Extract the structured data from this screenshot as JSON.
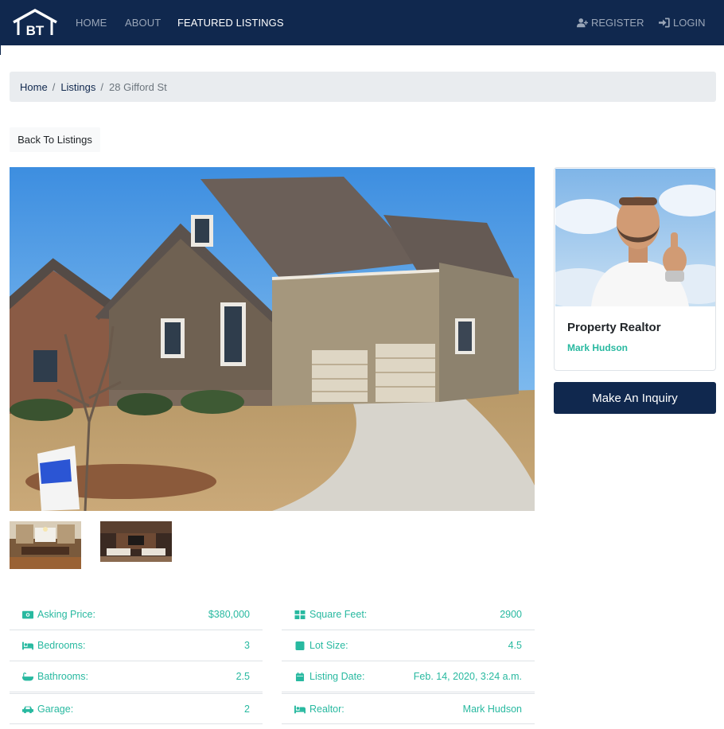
{
  "navbar": {
    "logo_text": "BT",
    "links": [
      "HOME",
      "ABOUT",
      "FEATURED LISTINGS"
    ],
    "register_label": "REGISTER",
    "login_label": "LOGIN"
  },
  "breadcrumb": {
    "home": "Home",
    "listings": "Listings",
    "separator": "/",
    "current": "28 Gifford St"
  },
  "back_button": "Back To Listings",
  "realtor_card": {
    "title": "Property Realtor",
    "name": "Mark Hudson"
  },
  "inquiry_button": "Make An Inquiry",
  "details_left": [
    {
      "icon": "money-icon",
      "label": "Asking Price:",
      "value": "$380,000"
    },
    {
      "icon": "bed-icon",
      "label": "Bedrooms:",
      "value": "3"
    },
    {
      "icon": "bath-icon",
      "label": "Bathrooms:",
      "value": "2.5"
    },
    {
      "icon": "car-icon",
      "label": "Garage:",
      "value": "2"
    }
  ],
  "details_right": [
    {
      "icon": "grid-icon",
      "label": "Square Feet:",
      "value": "2900"
    },
    {
      "icon": "square-icon",
      "label": "Lot Size:",
      "value": "4.5"
    },
    {
      "icon": "calendar-icon",
      "label": "Listing Date:",
      "value": "Feb. 14, 2020, 3:24 a.m."
    },
    {
      "icon": "bed-icon",
      "label": "Realtor:",
      "value": "Mark Hudson"
    }
  ],
  "colors": {
    "navbar": "#10284e",
    "accent": "#28b9a0",
    "breadcrumb_bg": "#e9ecef"
  }
}
